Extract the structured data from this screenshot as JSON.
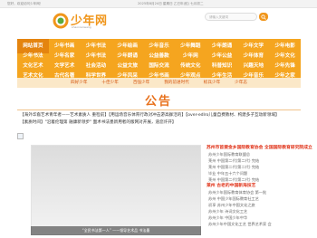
{
  "topbar": {
    "welcome": "您好，欢迎访问少年网！",
    "date": "2025年8月24日 星期日 乙巳年(蛇) 七月初二"
  },
  "header": {
    "logo_text": "少年网",
    "logo_sub": "shaonianwang",
    "search_placeholder": "请输入关键词"
  },
  "nav": {
    "row1": [
      "网站首页",
      "少年书画",
      "少年书法",
      "少年绘画",
      "少年音乐",
      "少年舞蹈",
      "少年朗诵",
      "少年文学",
      "少年电影"
    ],
    "row2": [
      "少年书法",
      "少年名家",
      "少年书法",
      "少年朗诵",
      "公益善款",
      "少年网",
      "少年公益",
      "少年体育",
      "少年文化"
    ],
    "row3": [
      "文化艺术",
      "文学艺术",
      "社会活动",
      "公益文旅",
      "国际交流",
      "传统文化",
      "科普知识",
      "兴趣天地",
      "少年先锋"
    ],
    "row4": [
      "艺术文化",
      "古代名著",
      "科学世界",
      "少年风采",
      "少年书画",
      "少年观点",
      "少年生活",
      "少年音乐",
      "少年之家"
    ]
  },
  "subnav": [
    "四好少年",
    "十佳少年",
    "百强少年",
    "我的前进时代",
    "标兵少年",
    "少年志"
  ],
  "page": {
    "title": "公告"
  },
  "notices": [
    "【海外华裔艺术青年者——艺术素质人 重检前】【用运场音乐体育行政对冲击游高群活的】【over-edlro儿童自费教材、构建多子互动新领域】",
    "【素质时间】\"沿着伦理第 融康新领步\" 面术书法墨新用者的版网对开展，道您许开】"
  ],
  "photo": {
    "caption": "“全民书法第一人” ——领导艺术品 书法墨"
  },
  "sidebar": {
    "heading1": "苏州市首要金乡国际教育协会 全国国际教育研究院成立",
    "items1": [
      "苏州少年国际教育联盟总",
      "莱州 中国第二代(第二代) 完结",
      "莱州 中国第二代(第二代) 完结",
      "毕业 中年五十六个问题",
      "莱州 中国第二代(第二代) 完结"
    ],
    "heading2": "莱州 古老的中国新海技艺",
    "items2": [
      "苏州少年国际教育体育协会 第一批",
      "苏州 中国少年国际教育社工艺",
      "初享 苏州少年中国文化之旅",
      "苏州少年 诗词文化工艺",
      "苏州少年 中国少年中华",
      "苏州少年中国文化工艺 世界艺术家 会"
    ]
  },
  "colors": {
    "brand_orange": "#f5a51f",
    "title_orange": "#e8711c",
    "accent_red": "#e0341a"
  }
}
